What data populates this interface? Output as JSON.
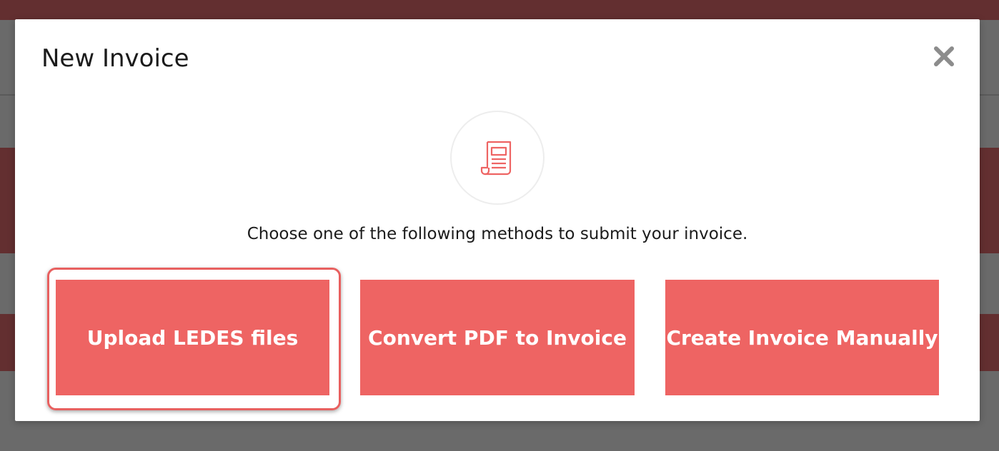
{
  "modal": {
    "title": "New Invoice",
    "close_icon": "close-icon",
    "hero_icon": "invoice-document-icon",
    "instructions": "Choose one of the following methods to submit your invoice.",
    "methods": [
      {
        "label": "Upload LEDES files",
        "focused": true
      },
      {
        "label": "Convert PDF to Invoice",
        "focused": false
      },
      {
        "label": "Create Invoice Manually",
        "focused": false
      }
    ]
  },
  "colors": {
    "accent": "#ee6463",
    "backdrop": "#6a6a6a",
    "page_band": "#632f30",
    "close_icon": "#8c8c8c",
    "title_text": "#1b1b1b"
  }
}
